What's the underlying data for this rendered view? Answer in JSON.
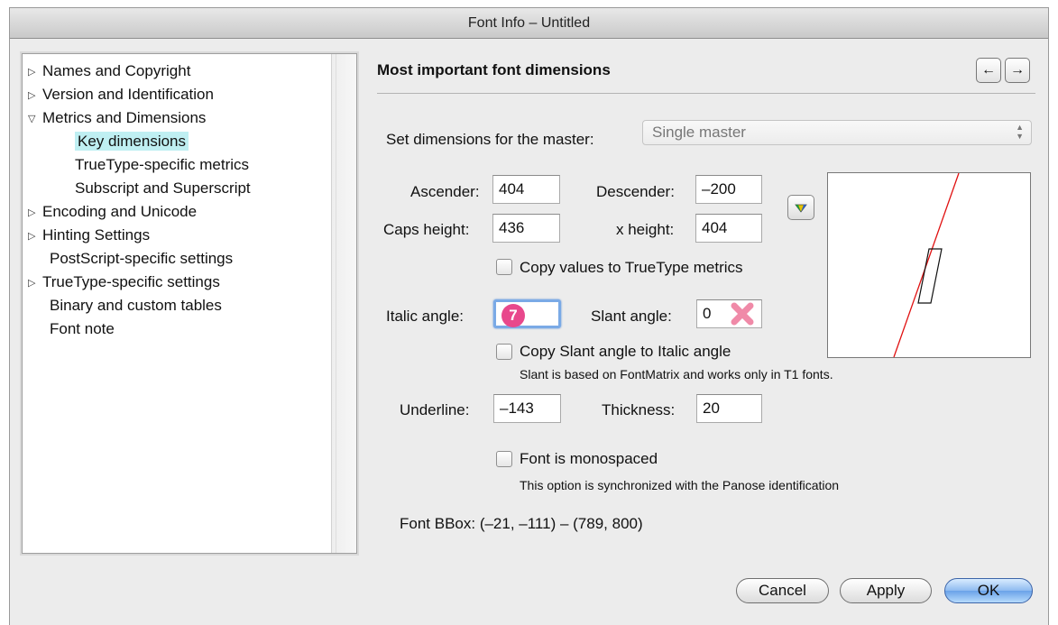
{
  "window": {
    "title": "Font Info – Untitled"
  },
  "tree": {
    "items": [
      {
        "label": "Names and Copyright"
      },
      {
        "label": "Version and Identification"
      },
      {
        "label": "Metrics and Dimensions"
      },
      {
        "label": "Key dimensions"
      },
      {
        "label": "TrueType-specific metrics"
      },
      {
        "label": "Subscript and Superscript"
      },
      {
        "label": "Encoding and Unicode"
      },
      {
        "label": "Hinting Settings"
      },
      {
        "label": "PostScript-specific settings"
      },
      {
        "label": "TrueType-specific settings"
      },
      {
        "label": "Binary and custom tables"
      },
      {
        "label": "Font note"
      }
    ],
    "selected": "Key dimensions"
  },
  "pane": {
    "title": "Most important font dimensions",
    "prev_icon": "arrow-left-icon",
    "next_icon": "arrow-right-icon"
  },
  "master": {
    "label": "Set dimensions for the master:",
    "value": "Single master"
  },
  "fields": {
    "ascender": {
      "label": "Ascender:",
      "value": "404"
    },
    "descender": {
      "label": "Descender:",
      "value": "–200"
    },
    "caps_height": {
      "label": "Caps height:",
      "value": "436"
    },
    "x_height": {
      "label": "x height:",
      "value": "404"
    },
    "italic_angle": {
      "label": "Italic angle:",
      "value": "",
      "badge": "7"
    },
    "slant_angle": {
      "label": "Slant angle:",
      "value": "0"
    },
    "underline": {
      "label": "Underline:",
      "value": "–143"
    },
    "thickness": {
      "label": "Thickness:",
      "value": "20"
    }
  },
  "checkboxes": {
    "copy_truetype": {
      "label": "Copy values to TrueType metrics",
      "checked": false
    },
    "copy_slant": {
      "label": "Copy Slant angle to Italic angle",
      "checked": false,
      "note": "Slant is based on FontMatrix and works only in T1 fonts."
    },
    "monospaced": {
      "label": "Font is monospaced",
      "checked": false,
      "note": "This option is synchronized with the Panose identification"
    }
  },
  "bbox": "Font BBox: (–21, –111) – (789, 800)",
  "buttons": {
    "cancel": "Cancel",
    "apply": "Apply",
    "ok": "OK"
  },
  "colors": {
    "accent": "#6aa2e8",
    "selection": "#bfeff2",
    "badge": "#e8488c",
    "error_mark": "#f08aa8",
    "preview_line": "#e01010"
  }
}
